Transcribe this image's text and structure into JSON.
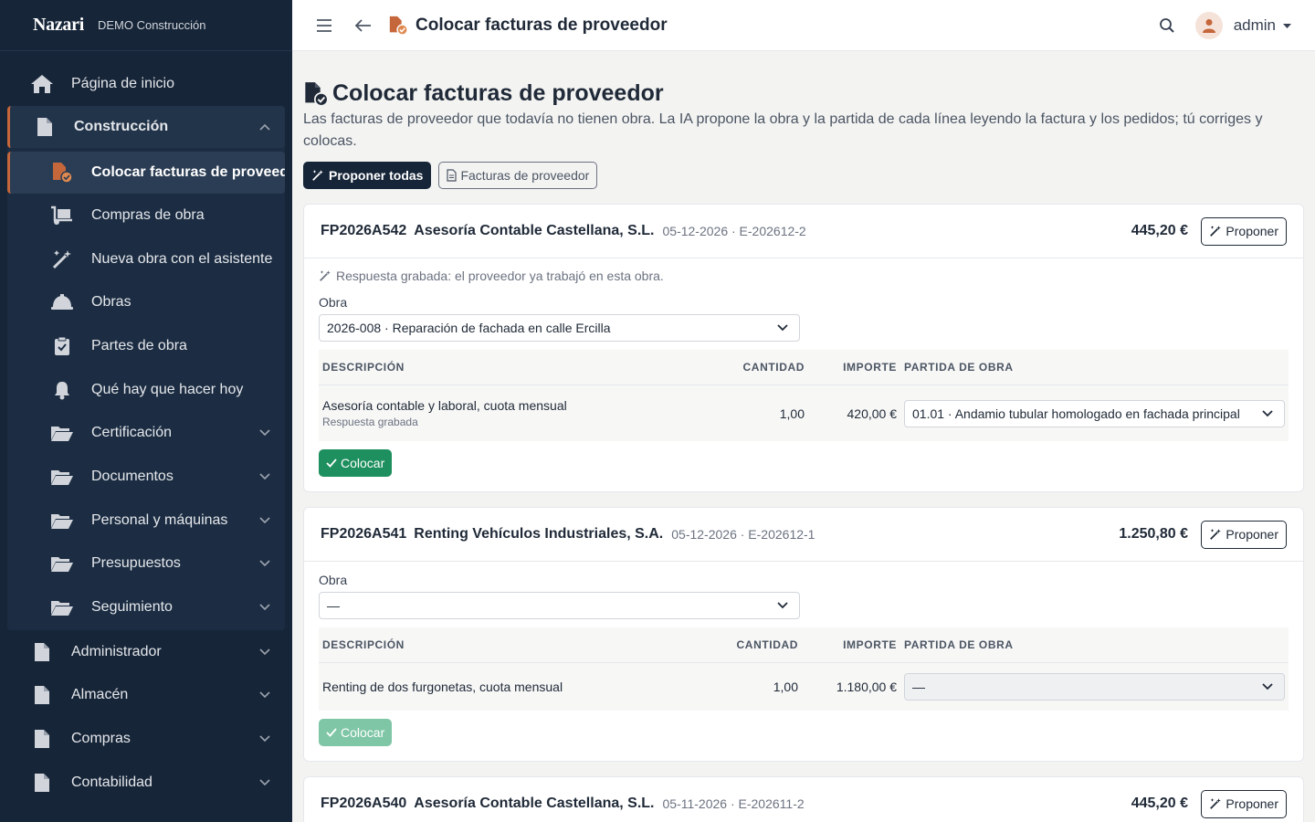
{
  "brand": {
    "logo": "Nazari",
    "company": "DEMO Construcción"
  },
  "sidebar": {
    "home": {
      "label": "Página de inicio",
      "icon": "home-icon"
    },
    "group": {
      "label": "Construcción",
      "icon": "file-icon",
      "items": [
        {
          "label": "Colocar facturas de proveedor",
          "icon": "file-check-icon",
          "active": true
        },
        {
          "label": "Compras de obra",
          "icon": "dolly-icon"
        },
        {
          "label": "Nueva obra con el asistente",
          "icon": "magic-wand-icon"
        },
        {
          "label": "Obras",
          "icon": "helmet-icon"
        },
        {
          "label": "Partes de obra",
          "icon": "clipboard-check-icon"
        },
        {
          "label": "Qué hay que hacer hoy",
          "icon": "bell-icon"
        },
        {
          "label": "Certificación",
          "icon": "folder-open-icon"
        },
        {
          "label": "Documentos",
          "icon": "folder-open-icon"
        },
        {
          "label": "Personal y máquinas",
          "icon": "folder-open-icon"
        },
        {
          "label": "Presupuestos",
          "icon": "folder-open-icon"
        },
        {
          "label": "Seguimiento",
          "icon": "folder-open-icon"
        }
      ]
    },
    "bottom": [
      {
        "label": "Administrador",
        "icon": "file-icon"
      },
      {
        "label": "Almacén",
        "icon": "file-icon"
      },
      {
        "label": "Compras",
        "icon": "file-icon"
      },
      {
        "label": "Contabilidad",
        "icon": "file-icon"
      }
    ]
  },
  "topbar": {
    "title": "Colocar facturas de proveedor",
    "user": "admin"
  },
  "page": {
    "title": "Colocar facturas de proveedor",
    "description": "Las facturas de proveedor que todavía no tienen obra. La IA propone la obra y la partida de cada línea leyendo la factura y los pedidos; tú corriges y colocas.",
    "propose_all": "Proponer todas",
    "supplier_invoices": "Facturas de proveedor"
  },
  "table_headers": {
    "description": "DESCRIPCIÓN",
    "quantity": "CANTIDAD",
    "amount": "IMPORTE",
    "item": "PARTIDA DE OBRA"
  },
  "labels": {
    "obra": "Obra",
    "propose": "Proponer",
    "place": "Colocar"
  },
  "invoices": [
    {
      "number": "FP2026A542",
      "supplier": "Asesoría Contable Castellana, S.L.",
      "meta": "05-12-2026 · E-202612-2",
      "amount": "445,20 €",
      "ai_note": "Respuesta grabada: el proveedor ya trabajó en esta obra.",
      "obra": "2026-008 · Reparación de fachada en calle Ercilla",
      "lines": [
        {
          "description": "Asesoría contable y laboral, cuota mensual",
          "sub": "Respuesta grabada",
          "quantity": "1,00",
          "amount": "420,00 €",
          "item": "01.01 · Andamio tubular homologado en fachada principal"
        }
      ]
    },
    {
      "number": "FP2026A541",
      "supplier": "Renting Vehículos Industriales, S.A.",
      "meta": "05-12-2026 · E-202612-1",
      "amount": "1.250,80 €",
      "obra": "—",
      "lines": [
        {
          "description": "Renting de dos furgonetas, cuota mensual",
          "quantity": "1,00",
          "amount": "1.180,00 €",
          "item": "—"
        }
      ]
    },
    {
      "number": "FP2026A540",
      "supplier": "Asesoría Contable Castellana, S.L.",
      "meta": "05-11-2026 · E-202611-2",
      "amount": "445,20 €"
    }
  ],
  "colors": {
    "sidebar_bg": "#162538",
    "accent": "#c5663b",
    "success": "#1e8f5e"
  }
}
